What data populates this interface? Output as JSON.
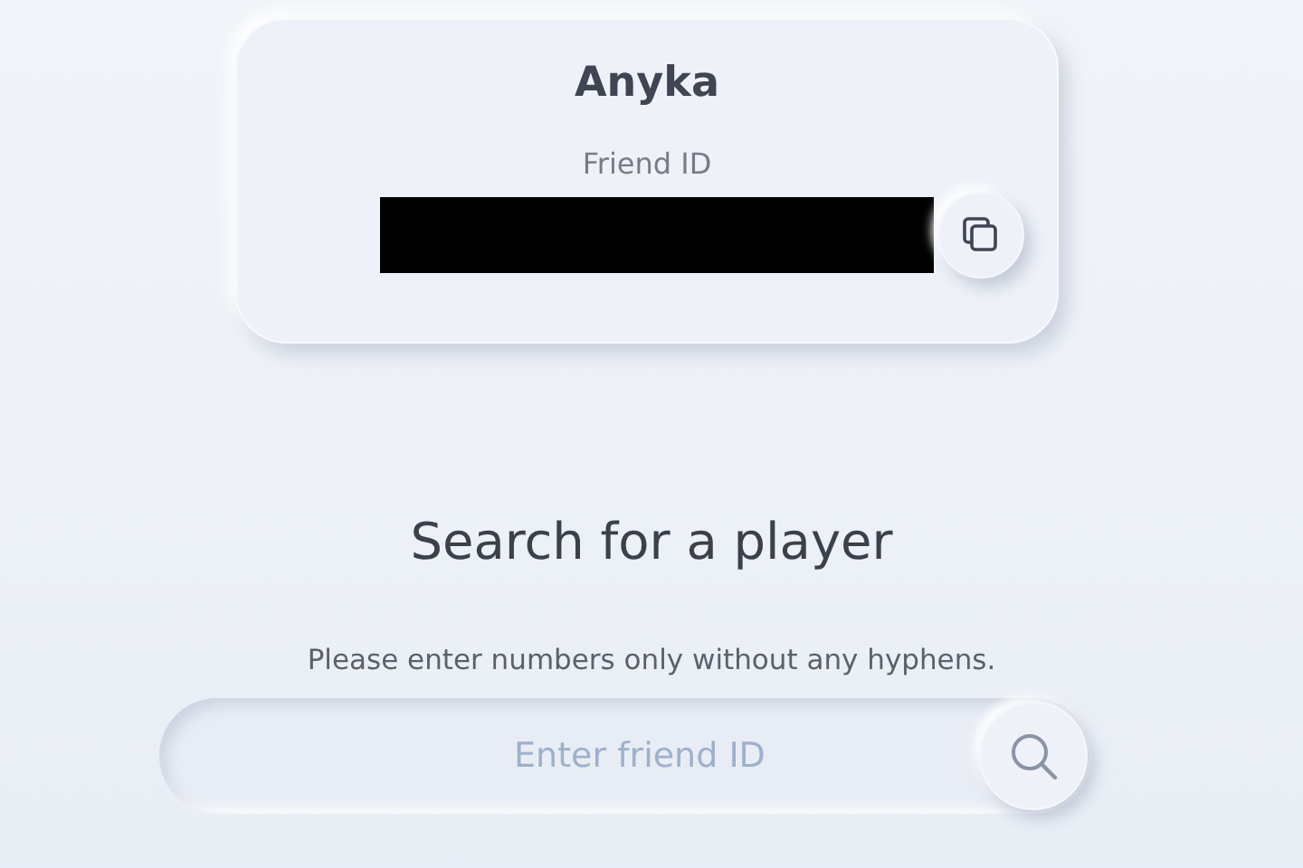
{
  "profile": {
    "name": "Anyka",
    "id_label": "Friend ID"
  },
  "search": {
    "title": "Search for a player",
    "hint": "Please enter numbers only without any hyphens.",
    "placeholder": "Enter friend ID"
  }
}
